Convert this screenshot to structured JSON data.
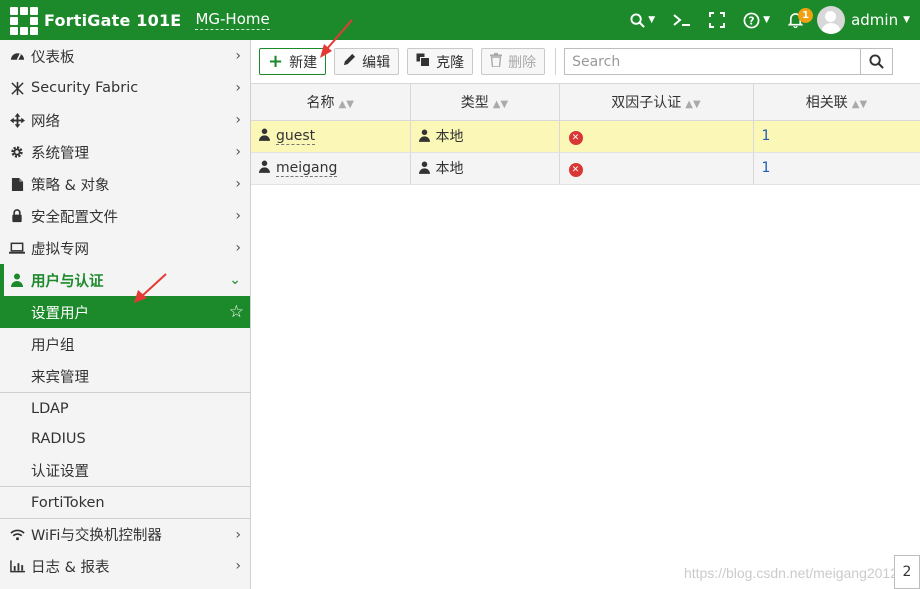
{
  "header": {
    "brand": "FortiGate 101E",
    "vdom": "MG-Home",
    "notification_count": "1",
    "user": "admin"
  },
  "sidebar": {
    "items": [
      {
        "label": "仪表板",
        "icon": "dashboard-icon"
      },
      {
        "label": "Security Fabric",
        "icon": "fabric-icon"
      },
      {
        "label": "网络",
        "icon": "network-move-icon"
      },
      {
        "label": "系统管理",
        "icon": "gear-icon"
      },
      {
        "label": "策略 & 对象",
        "icon": "policy-icon"
      },
      {
        "label": "安全配置文件",
        "icon": "lock-icon"
      },
      {
        "label": "虚拟专网",
        "icon": "laptop-icon"
      },
      {
        "label": "用户与认证",
        "icon": "user-icon"
      }
    ],
    "sub_items": [
      {
        "label": "设置用户"
      },
      {
        "label": "用户组"
      },
      {
        "label": "来宾管理"
      },
      {
        "label": "LDAP"
      },
      {
        "label": "RADIUS"
      },
      {
        "label": "认证设置"
      },
      {
        "label": "FortiToken"
      }
    ],
    "bottom_items": [
      {
        "label": "WiFi与交换机控制器",
        "icon": "wifi-icon"
      },
      {
        "label": "日志 & 报表",
        "icon": "chart-icon"
      }
    ]
  },
  "toolbar": {
    "new_label": "新建",
    "edit_label": "编辑",
    "clone_label": "克隆",
    "delete_label": "删除",
    "search_placeholder": "Search"
  },
  "table": {
    "columns": [
      "名称",
      "类型",
      "双因子认证",
      "相关联"
    ],
    "rows": [
      {
        "name": "guest",
        "type": "本地",
        "ref": "1"
      },
      {
        "name": "meigang",
        "type": "本地",
        "ref": "1"
      }
    ]
  },
  "pager": {
    "page": "2"
  },
  "watermark": "https://blog.csdn.net/meigang2012",
  "colors": {
    "brand": "#1c8a2b",
    "selected_row": "#fbf8b7",
    "error": "#d93636",
    "arrow": "#e53935"
  }
}
